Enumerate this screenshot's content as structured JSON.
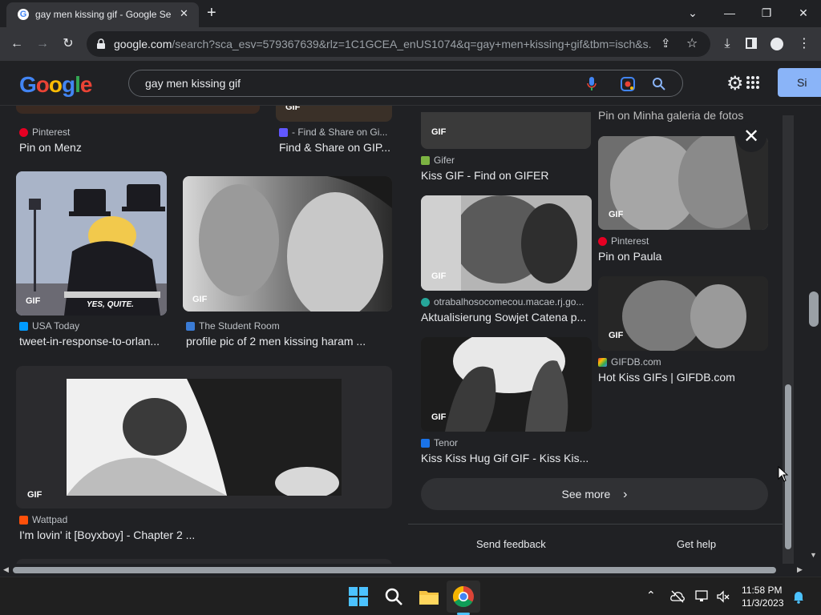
{
  "browser": {
    "tab_title": "gay men kissing gif - Google Se",
    "tab_close": "✕",
    "new_tab": "+",
    "url_domain": "google.com",
    "url_rest": "/search?sca_esv=579367639&rlz=1C1GCEA_enUS1074&q=gay+men+kissing+gif&tbm=isch&s..."
  },
  "google": {
    "search_query": "gay men kissing gif",
    "signin_label": "Si"
  },
  "results": {
    "col1": [
      {
        "source": "Pinterest",
        "title": "Pin on Menz",
        "fav_color": "#e60023"
      },
      {
        "source": "USA Today",
        "title": "tweet-in-response-to-orlan...",
        "fav_color": "#009bff"
      },
      {
        "source": "Wattpad",
        "title": "I'm lovin' it [Boyxboy] - Chapter 2 ...",
        "fav_color": "#ff500a"
      }
    ],
    "col2": [
      {
        "source": "- Find & Share on Gi...",
        "title": "Find & Share on GIP...",
        "fav_color": "#6157ff"
      },
      {
        "source": "The Student Room",
        "title": "profile pic of 2 men kissing haram ...",
        "fav_color": "#3a7bd5"
      }
    ],
    "simpsons_caption": "YES, QUITE."
  },
  "panel": {
    "items_left": [
      {
        "source": "Gifer",
        "title": "Kiss GIF - Find on GIFER",
        "fav_color": "#7cb342"
      },
      {
        "source": "otrabalhosocomecou.macae.rj.go...",
        "title": "Aktualisierung Sowjet Catena p...",
        "fav_color": "#26a69a"
      },
      {
        "source": "Tenor",
        "title": "Kiss Kiss Hug Gif GIF - Kiss Kis...",
        "fav_color": "#1a73e8"
      }
    ],
    "items_right": [
      {
        "source": "",
        "title": "Pin on Minha galeria de fotos",
        "fav_color": ""
      },
      {
        "source": "Pinterest",
        "title": "Pin on Paula",
        "fav_color": "#e60023"
      },
      {
        "source": "GIFDB.com",
        "title": "Hot Kiss GIFs | GIFDB.com",
        "fav_color": "#e53935"
      }
    ],
    "see_more": "See more",
    "send_feedback": "Send feedback",
    "get_help": "Get help",
    "gif_label": "GIF"
  },
  "taskbar": {
    "time": "11:58 PM",
    "date": "11/3/2023"
  }
}
